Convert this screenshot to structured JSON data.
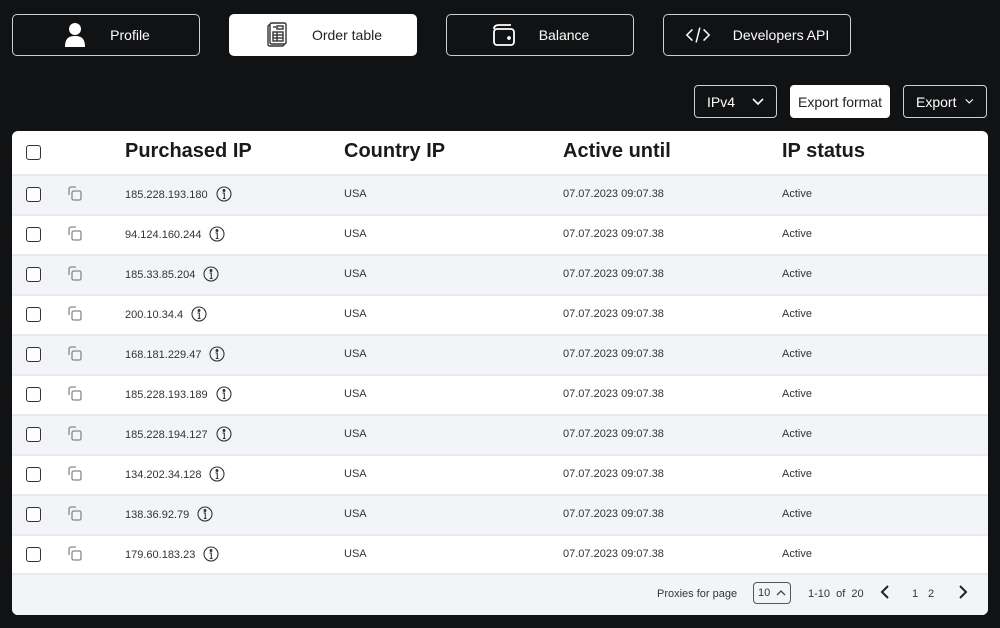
{
  "nav": {
    "tabs": [
      {
        "label": "Profile",
        "icon": "user-icon",
        "active": false
      },
      {
        "label": "Order table",
        "icon": "invoice-icon",
        "active": true
      },
      {
        "label": "Balance",
        "icon": "wallet-icon",
        "active": false
      },
      {
        "label": "Developers API",
        "icon": "code-icon",
        "active": false
      }
    ]
  },
  "toolbar": {
    "protocol_select": "IPv4",
    "export_format_label": "Export format",
    "export_label": "Export"
  },
  "table": {
    "columns": [
      "Purchased IP",
      "Country IP",
      "Active until",
      "IP status"
    ],
    "rows": [
      {
        "ip": "185.228.193.180",
        "country": "USA",
        "active_until": "07.07.2023 09:07.38",
        "status": "Active"
      },
      {
        "ip": "94.124.160.244",
        "country": "USA",
        "active_until": "07.07.2023 09:07.38",
        "status": "Active"
      },
      {
        "ip": "185.33.85.204",
        "country": "USA",
        "active_until": "07.07.2023 09:07.38",
        "status": "Active"
      },
      {
        "ip": "200.10.34.4",
        "country": "USA",
        "active_until": "07.07.2023 09:07.38",
        "status": "Active"
      },
      {
        "ip": "168.181.229.47",
        "country": "USA",
        "active_until": "07.07.2023 09:07.38",
        "status": "Active"
      },
      {
        "ip": "185.228.193.189",
        "country": "USA",
        "active_until": "07.07.2023 09:07.38",
        "status": "Active"
      },
      {
        "ip": "185.228.194.127",
        "country": "USA",
        "active_until": "07.07.2023 09:07.38",
        "status": "Active"
      },
      {
        "ip": "134.202.34.128",
        "country": "USA",
        "active_until": "07.07.2023 09:07.38",
        "status": "Active"
      },
      {
        "ip": "138.36.92.79",
        "country": "USA",
        "active_until": "07.07.2023 09:07.38",
        "status": "Active"
      },
      {
        "ip": "179.60.183.23",
        "country": "USA",
        "active_until": "07.07.2023 09:07.38",
        "status": "Active"
      }
    ]
  },
  "pagination": {
    "per_page_label": "Proxies for page",
    "per_page_value": "10",
    "range_text": "1-10  of  20",
    "pages": [
      "1",
      "2"
    ]
  },
  "colors": {
    "background": "#111214",
    "card": "#ffffff",
    "row_alt": "#f3f4f8",
    "row_border": "#e9eaee"
  }
}
